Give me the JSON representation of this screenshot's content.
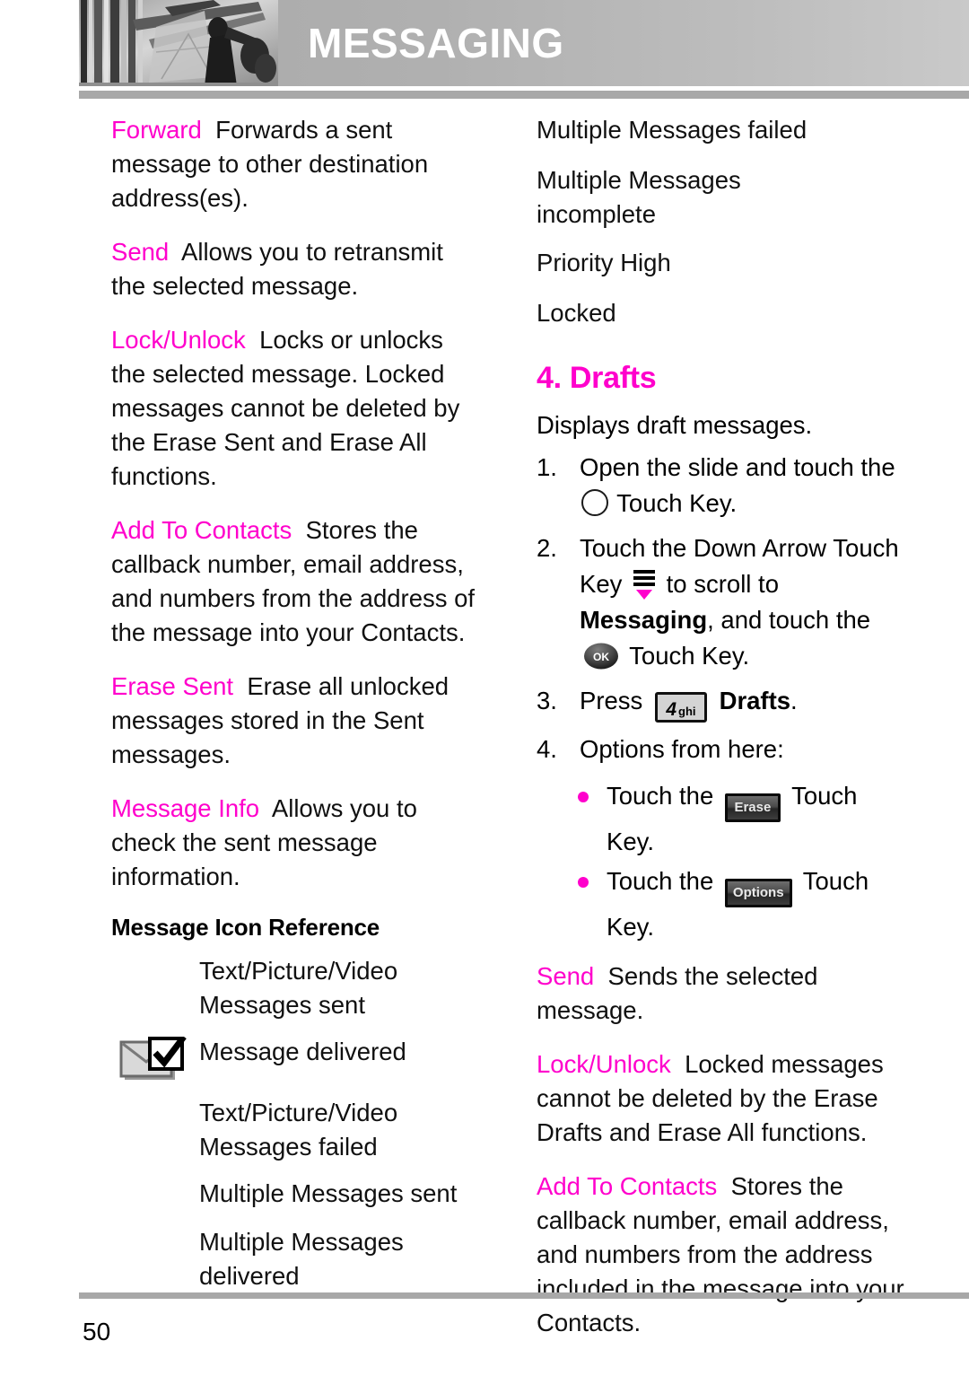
{
  "header": {
    "title": "MESSAGING",
    "photo_alt": "grayscale-architecture-photo"
  },
  "left_column": {
    "entries": [
      {
        "term": "Forward",
        "desc": "Forwards a sent message to other destination address(es)."
      },
      {
        "term": "Send",
        "desc": "Allows you to retransmit the selected message."
      },
      {
        "term": "Lock/Unlock",
        "desc": "Locks or unlocks the selected message. Locked messages cannot be deleted by the Erase Sent and Erase All functions."
      },
      {
        "term": "Add To Contacts",
        "desc": "Stores the callback number, email address, and numbers from the address of the message into your Contacts."
      },
      {
        "term": "Erase Sent",
        "desc": "Erase all unlocked messages stored in the Sent messages."
      },
      {
        "term": "Message Info",
        "desc": "Allows you to check the sent message information."
      }
    ],
    "icon_reference": {
      "title": "Message Icon Reference",
      "rows": [
        {
          "icon": "",
          "label": "Text/Picture/Video Messages sent"
        },
        {
          "icon": "envelope-check-icon",
          "label": "Message delivered"
        },
        {
          "icon": "",
          "label": "Text/Picture/Video Messages failed"
        },
        {
          "icon": "",
          "label": "Multiple Messages sent"
        },
        {
          "icon": "",
          "label": "Multiple Messages delivered"
        }
      ]
    }
  },
  "right_column": {
    "icon_reference_continued": [
      {
        "icon": "",
        "label": "Multiple Messages failed"
      },
      {
        "icon": "",
        "label": "Multiple Messages incomplete"
      },
      {
        "icon": "",
        "label": "Priority High"
      },
      {
        "icon": "",
        "label": "Locked"
      }
    ],
    "section": {
      "heading": "4. Drafts",
      "lead": "Displays draft messages.",
      "steps": [
        {
          "num": "1.",
          "parts": [
            "Open the slide and touch the ",
            "[circle-key]",
            " Touch Key."
          ]
        },
        {
          "num": "2.",
          "parts": [
            "Touch the Down Arrow Touch Key ",
            "[down-arrow-key]",
            " to scroll to ",
            "Messaging",
            ", and touch the ",
            "[ok-key]",
            " Touch Key."
          ]
        },
        {
          "num": "3.",
          "parts": [
            "Press ",
            "[4ghi-key]",
            " ",
            "Drafts",
            "."
          ]
        },
        {
          "num": "4.",
          "parts": [
            "Options from here:"
          ]
        }
      ],
      "step_text": {
        "s1_a": "Open the slide and touch the",
        "s1_b": "Touch Key.",
        "s2_a": "Touch the Down Arrow Touch Key",
        "s2_b": "to scroll to",
        "s2_bold": "Messaging",
        "s2_c": ", and touch the",
        "s2_d": "Touch Key.",
        "s3_a": "Press",
        "s3_bold": "Drafts",
        "s3_b": ".",
        "s4_a": "Options from here:"
      },
      "bullets": [
        {
          "pre": "Touch the",
          "key": "Erase",
          "post": "Touch Key."
        },
        {
          "pre": "Touch the",
          "key": "Options",
          "post": "Touch Key."
        }
      ],
      "entries": [
        {
          "term": "Send",
          "desc": "Sends the selected message."
        },
        {
          "term": "Lock/Unlock",
          "desc": "Locked messages cannot be deleted by the Erase Drafts and Erase All functions."
        },
        {
          "term": "Add To Contacts",
          "desc": "Stores the callback number, email address, and numbers from the address included in the message into your Contacts."
        }
      ]
    }
  },
  "keys": {
    "num_digit": "4",
    "num_letters": "ghi",
    "ok_label": "OK",
    "erase_label": "Erase",
    "options_label": "Options"
  },
  "footer": {
    "page_number": "50"
  },
  "colors": {
    "accent": "#ff00cc",
    "header_gray": "#b0b0b0",
    "rule_gray": "#a8a8a8"
  }
}
